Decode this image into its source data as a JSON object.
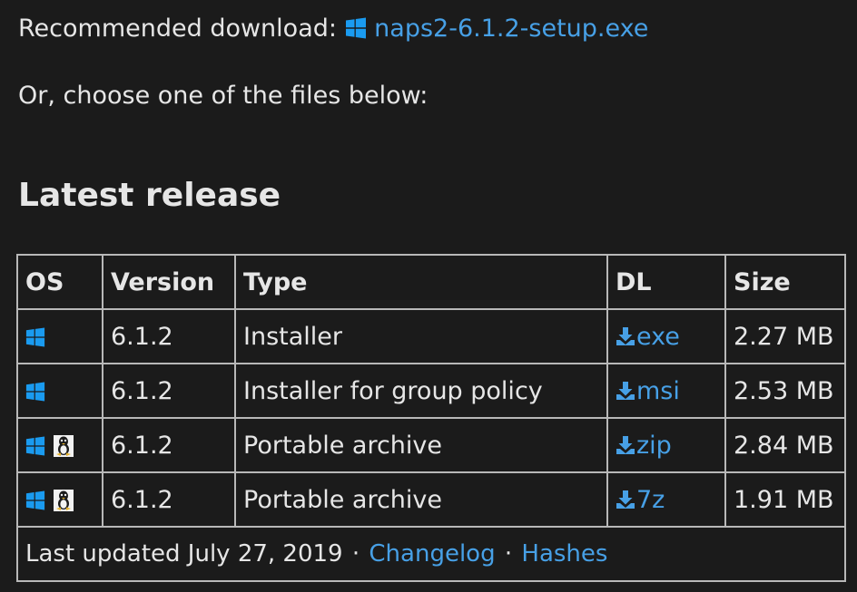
{
  "recommended": {
    "label": "Recommended download:",
    "file": "naps2-6.1.2-setup.exe"
  },
  "choose_text": "Or, choose one of the files below:",
  "heading": "Latest release",
  "table": {
    "headers": [
      "OS",
      "Version",
      "Type",
      "DL",
      "Size"
    ],
    "rows": [
      {
        "os": [
          "windows-icon"
        ],
        "version": "6.1.2",
        "type": "Installer",
        "dl": "exe",
        "size": "2.27 MB"
      },
      {
        "os": [
          "windows-icon"
        ],
        "version": "6.1.2",
        "type": "Installer for group policy",
        "dl": "msi",
        "size": "2.53 MB"
      },
      {
        "os": [
          "windows-icon",
          "linux-icon"
        ],
        "version": "6.1.2",
        "type": "Portable archive",
        "dl": "zip",
        "size": "2.84 MB"
      },
      {
        "os": [
          "windows-icon",
          "linux-icon"
        ],
        "version": "6.1.2",
        "type": "Portable archive",
        "dl": "7z",
        "size": "1.91 MB"
      }
    ],
    "footer": {
      "updated": "Last updated July 27, 2019",
      "separator": "·",
      "changelog": "Changelog",
      "hashes": "Hashes"
    }
  },
  "colors": {
    "background": "#1b1b1b",
    "text": "#e6e6e6",
    "link": "#47a0e6",
    "windows_icon": "#1a9bf0",
    "border": "#b8b8b8"
  }
}
